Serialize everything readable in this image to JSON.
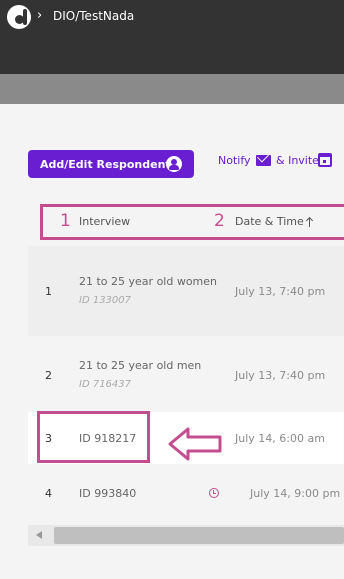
{
  "header": {
    "breadcrumb": "DIO/TestNada",
    "chevron": "›",
    "logo_icon": "d-logo-icon",
    "colors": {
      "topbar": "#333333",
      "subbar": "#8a8a8a"
    }
  },
  "toolbar": {
    "add_edit_label": "Add/Edit Respondents",
    "add_edit_icon": "user-circle-icon",
    "notify_label": "Notify",
    "notify_icon": "mail-icon",
    "invite_label": "& Invite",
    "invite_icon": "calendar-icon",
    "accent": "#6a1ed2"
  },
  "table": {
    "headers": [
      {
        "number": "1",
        "label": "Interview"
      },
      {
        "number": "2",
        "label": "Date & Time",
        "sort": "ascending",
        "sort_icon": "arrow-up-icon"
      }
    ],
    "rows": [
      {
        "index": "1",
        "title": "21 to 25 year old women",
        "id": "ID 133007",
        "datetime": "July 13, 7:40 pm"
      },
      {
        "index": "2",
        "title": "21 to 25 year old men",
        "id": "ID 716437",
        "datetime": "July 13, 7:40 pm"
      },
      {
        "index": "3",
        "title": "ID 918217",
        "id": "",
        "datetime": "July 14, 6:00 am"
      },
      {
        "index": "4",
        "title": "ID 993840",
        "id": "",
        "datetime": "July 14, 9:00 pm",
        "status_icon": "clock-icon"
      }
    ]
  },
  "annotations": {
    "highlight_color": "#c44d8f",
    "arrow_icon": "left-arrow-outline-icon"
  },
  "scrollbar": {
    "left_icon": "scroll-left-arrow-icon"
  }
}
